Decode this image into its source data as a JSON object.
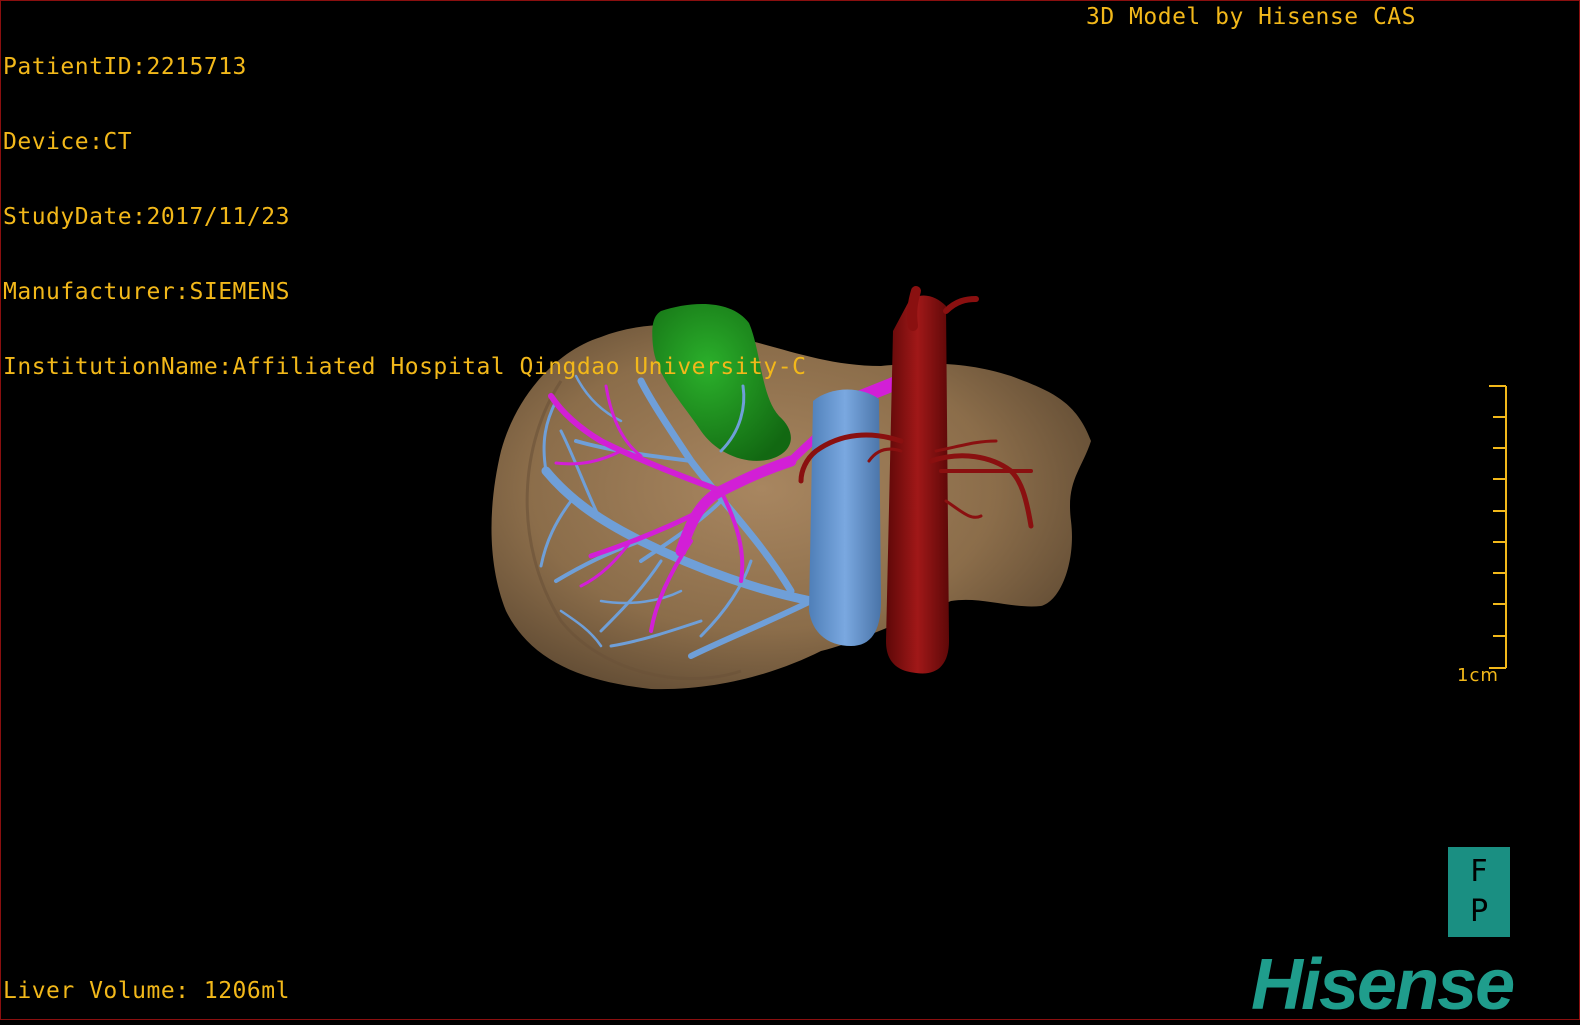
{
  "header": {
    "patient_id": "PatientID:2215713",
    "device": "Device:CT",
    "study_date": "StudyDate:2017/11/23",
    "manufacturer": "Manufacturer:SIEMENS",
    "institution": "InstitutionName:Affiliated Hospital Qingdao University-C",
    "credit": "3D Model by Hisense CAS"
  },
  "footer": {
    "liver_volume": "Liver Volume: 1206ml"
  },
  "scale_bar": {
    "label": "1cm"
  },
  "orientation": {
    "top": "F",
    "bottom": "P"
  },
  "brand": {
    "logo_text": "Hisense"
  },
  "colors": {
    "overlay_text": "#f2b81a",
    "liver": "#8b6d4a",
    "gallbladder": "#1d8f1d",
    "hepatic_vein": "#6f9fd8",
    "portal_vein": "#d21fd6",
    "aorta": "#8a1010",
    "brand": "#1f9d8c"
  }
}
